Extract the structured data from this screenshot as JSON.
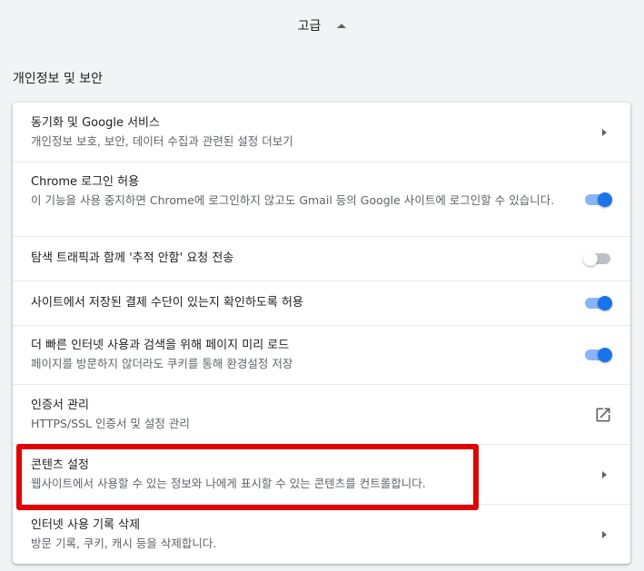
{
  "advanced": {
    "label": "고급"
  },
  "section": {
    "title": "개인정보 및 보안"
  },
  "rows": [
    {
      "title": "동기화 및 Google 서비스",
      "subtitle": "개인정보 보호, 보안, 데이터 수집과 관련된 설정 더보기",
      "control": "chevron-right-icon"
    },
    {
      "title": "Chrome 로그인 허용",
      "subtitle": "이 기능을 사용 중지하면 Chrome에 로그인하지 않고도 Gmail 등의 Google 사이트에 로그인할 수 있습니다.",
      "control": "toggle",
      "state": "on"
    },
    {
      "title": "탐색 트래픽과 함께 '추적 안함' 요청 전송",
      "control": "toggle",
      "state": "off"
    },
    {
      "title": "사이트에서 저장된 결제 수단이 있는지 확인하도록 허용",
      "control": "toggle",
      "state": "on"
    },
    {
      "title": "더 빠른 인터넷 사용과 검색을 위해 페이지 미리 로드",
      "subtitle": "페이지를 방문하지 않더라도 쿠키를 통해 환경설정 저장",
      "control": "toggle",
      "state": "on"
    },
    {
      "title": "인증서 관리",
      "subtitle": "HTTPS/SSL 인증서 및 설정 관리",
      "control": "external-link-icon"
    },
    {
      "title": "콘텐츠 설정",
      "subtitle": "웹사이트에서 사용할 수 있는 정보와 나에게 표시할 수 있는 콘텐츠를 컨트롤합니다.",
      "control": "chevron-right-icon"
    },
    {
      "title": "인터넷 사용 기록 삭제",
      "subtitle": "방문 기록, 쿠키, 캐시 등을 삭제합니다.",
      "control": "chevron-right-icon"
    }
  ],
  "colors": {
    "background": "#f1f3f4",
    "toggle_on_track": "#8ab4f8",
    "toggle_on_knob": "#1a73e8",
    "toggle_off_track": "#bdc1c6",
    "highlight_border": "#e00000"
  }
}
